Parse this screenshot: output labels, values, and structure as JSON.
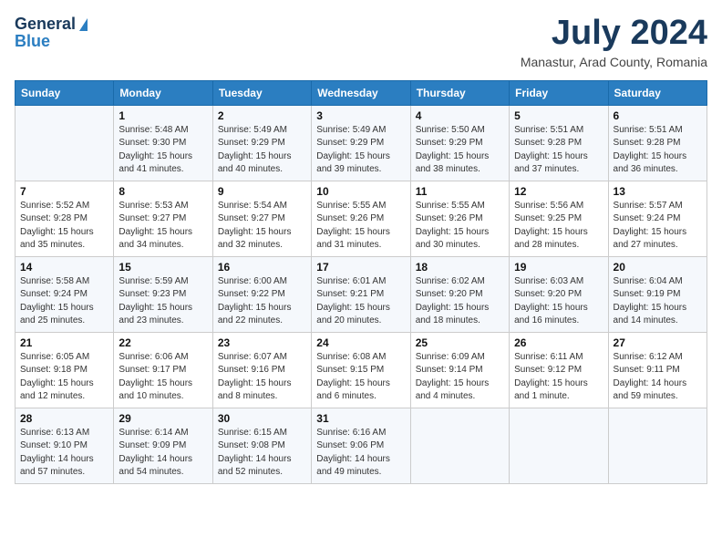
{
  "header": {
    "logo_general": "General",
    "logo_blue": "Blue",
    "title": "July 2024",
    "subtitle": "Manastur, Arad County, Romania"
  },
  "weekdays": [
    "Sunday",
    "Monday",
    "Tuesday",
    "Wednesday",
    "Thursday",
    "Friday",
    "Saturday"
  ],
  "weeks": [
    [
      {
        "day": "",
        "info": ""
      },
      {
        "day": "1",
        "info": "Sunrise: 5:48 AM\nSunset: 9:30 PM\nDaylight: 15 hours\nand 41 minutes."
      },
      {
        "day": "2",
        "info": "Sunrise: 5:49 AM\nSunset: 9:29 PM\nDaylight: 15 hours\nand 40 minutes."
      },
      {
        "day": "3",
        "info": "Sunrise: 5:49 AM\nSunset: 9:29 PM\nDaylight: 15 hours\nand 39 minutes."
      },
      {
        "day": "4",
        "info": "Sunrise: 5:50 AM\nSunset: 9:29 PM\nDaylight: 15 hours\nand 38 minutes."
      },
      {
        "day": "5",
        "info": "Sunrise: 5:51 AM\nSunset: 9:28 PM\nDaylight: 15 hours\nand 37 minutes."
      },
      {
        "day": "6",
        "info": "Sunrise: 5:51 AM\nSunset: 9:28 PM\nDaylight: 15 hours\nand 36 minutes."
      }
    ],
    [
      {
        "day": "7",
        "info": "Sunrise: 5:52 AM\nSunset: 9:28 PM\nDaylight: 15 hours\nand 35 minutes."
      },
      {
        "day": "8",
        "info": "Sunrise: 5:53 AM\nSunset: 9:27 PM\nDaylight: 15 hours\nand 34 minutes."
      },
      {
        "day": "9",
        "info": "Sunrise: 5:54 AM\nSunset: 9:27 PM\nDaylight: 15 hours\nand 32 minutes."
      },
      {
        "day": "10",
        "info": "Sunrise: 5:55 AM\nSunset: 9:26 PM\nDaylight: 15 hours\nand 31 minutes."
      },
      {
        "day": "11",
        "info": "Sunrise: 5:55 AM\nSunset: 9:26 PM\nDaylight: 15 hours\nand 30 minutes."
      },
      {
        "day": "12",
        "info": "Sunrise: 5:56 AM\nSunset: 9:25 PM\nDaylight: 15 hours\nand 28 minutes."
      },
      {
        "day": "13",
        "info": "Sunrise: 5:57 AM\nSunset: 9:24 PM\nDaylight: 15 hours\nand 27 minutes."
      }
    ],
    [
      {
        "day": "14",
        "info": "Sunrise: 5:58 AM\nSunset: 9:24 PM\nDaylight: 15 hours\nand 25 minutes."
      },
      {
        "day": "15",
        "info": "Sunrise: 5:59 AM\nSunset: 9:23 PM\nDaylight: 15 hours\nand 23 minutes."
      },
      {
        "day": "16",
        "info": "Sunrise: 6:00 AM\nSunset: 9:22 PM\nDaylight: 15 hours\nand 22 minutes."
      },
      {
        "day": "17",
        "info": "Sunrise: 6:01 AM\nSunset: 9:21 PM\nDaylight: 15 hours\nand 20 minutes."
      },
      {
        "day": "18",
        "info": "Sunrise: 6:02 AM\nSunset: 9:20 PM\nDaylight: 15 hours\nand 18 minutes."
      },
      {
        "day": "19",
        "info": "Sunrise: 6:03 AM\nSunset: 9:20 PM\nDaylight: 15 hours\nand 16 minutes."
      },
      {
        "day": "20",
        "info": "Sunrise: 6:04 AM\nSunset: 9:19 PM\nDaylight: 15 hours\nand 14 minutes."
      }
    ],
    [
      {
        "day": "21",
        "info": "Sunrise: 6:05 AM\nSunset: 9:18 PM\nDaylight: 15 hours\nand 12 minutes."
      },
      {
        "day": "22",
        "info": "Sunrise: 6:06 AM\nSunset: 9:17 PM\nDaylight: 15 hours\nand 10 minutes."
      },
      {
        "day": "23",
        "info": "Sunrise: 6:07 AM\nSunset: 9:16 PM\nDaylight: 15 hours\nand 8 minutes."
      },
      {
        "day": "24",
        "info": "Sunrise: 6:08 AM\nSunset: 9:15 PM\nDaylight: 15 hours\nand 6 minutes."
      },
      {
        "day": "25",
        "info": "Sunrise: 6:09 AM\nSunset: 9:14 PM\nDaylight: 15 hours\nand 4 minutes."
      },
      {
        "day": "26",
        "info": "Sunrise: 6:11 AM\nSunset: 9:12 PM\nDaylight: 15 hours\nand 1 minute."
      },
      {
        "day": "27",
        "info": "Sunrise: 6:12 AM\nSunset: 9:11 PM\nDaylight: 14 hours\nand 59 minutes."
      }
    ],
    [
      {
        "day": "28",
        "info": "Sunrise: 6:13 AM\nSunset: 9:10 PM\nDaylight: 14 hours\nand 57 minutes."
      },
      {
        "day": "29",
        "info": "Sunrise: 6:14 AM\nSunset: 9:09 PM\nDaylight: 14 hours\nand 54 minutes."
      },
      {
        "day": "30",
        "info": "Sunrise: 6:15 AM\nSunset: 9:08 PM\nDaylight: 14 hours\nand 52 minutes."
      },
      {
        "day": "31",
        "info": "Sunrise: 6:16 AM\nSunset: 9:06 PM\nDaylight: 14 hours\nand 49 minutes."
      },
      {
        "day": "",
        "info": ""
      },
      {
        "day": "",
        "info": ""
      },
      {
        "day": "",
        "info": ""
      }
    ]
  ]
}
